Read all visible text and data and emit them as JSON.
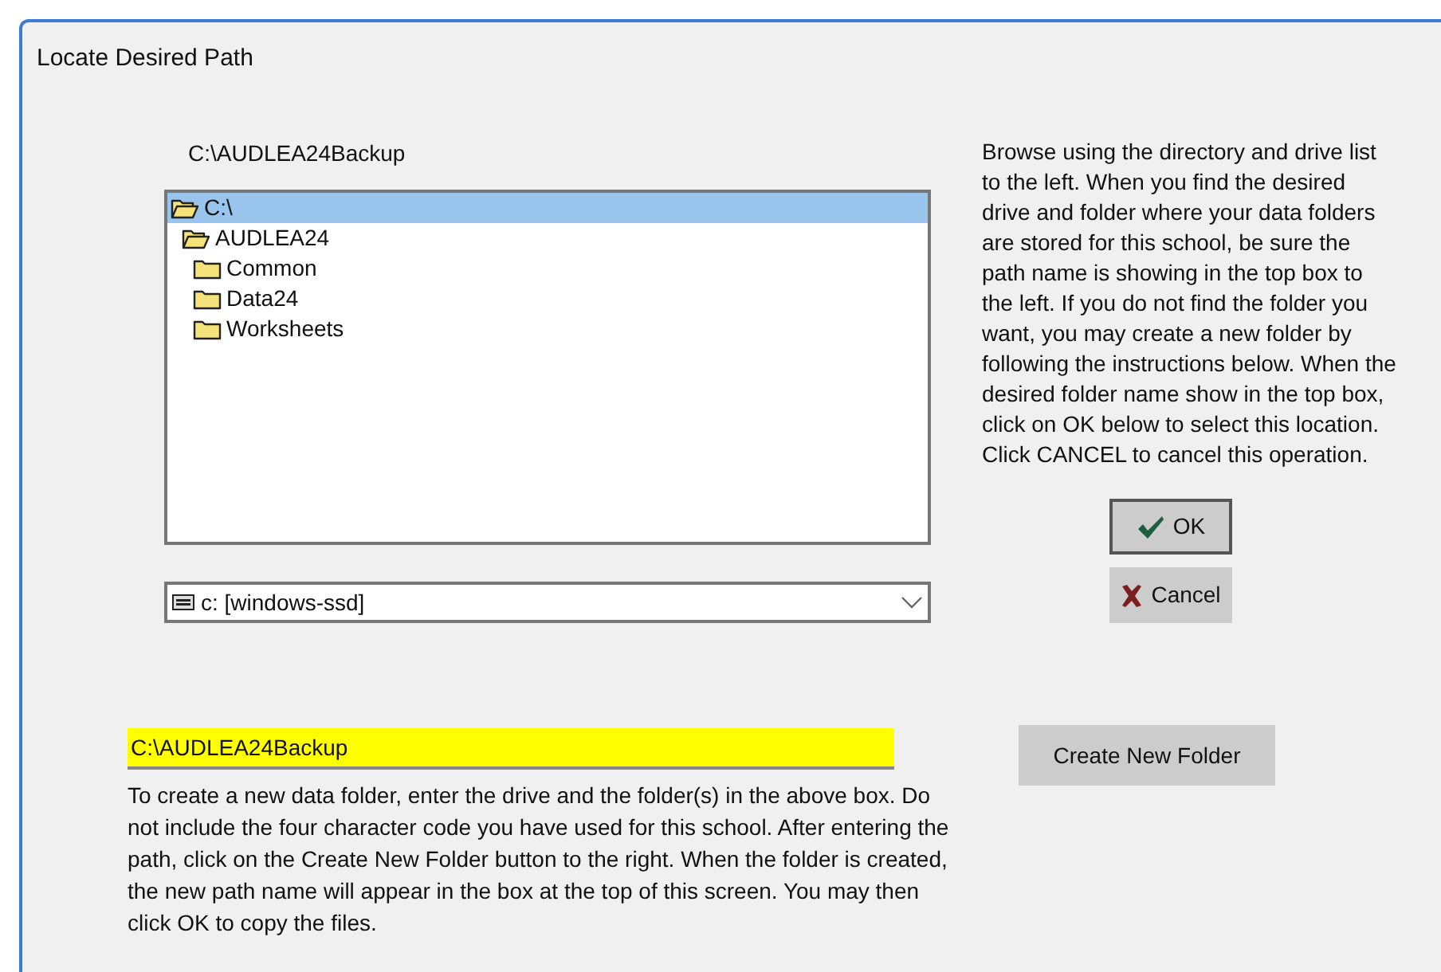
{
  "window": {
    "title": "Locate Desired Path"
  },
  "current_path": "C:\\AUDLEA24Backup",
  "tree": [
    {
      "label": "C:\\",
      "expanded": true,
      "selected": true,
      "children": [
        {
          "label": "AUDLEA24",
          "expanded": true,
          "selected": false,
          "children": [
            {
              "label": "Common",
              "expanded": false,
              "selected": false
            },
            {
              "label": "Data24",
              "expanded": false,
              "selected": false
            },
            {
              "label": "Worksheets",
              "expanded": false,
              "selected": false
            }
          ]
        }
      ]
    }
  ],
  "drive": {
    "value": "c: [windows-ssd]"
  },
  "help_text": "Browse using the directory and drive list to the left.  When you find the desired drive and folder where your data folders are stored for this school, be sure the path name is showing in the top box to the left.  If you do not find the folder you want, you may create a new folder by following the instructions below.  When the desired folder name show in the top box, click on OK below to select this location.  Click CANCEL to cancel this operation.",
  "buttons": [
    {
      "kind": "ok",
      "label": "OK"
    },
    {
      "kind": "cancel",
      "label": "Cancel"
    }
  ],
  "new_folder_field": {
    "value": "C:\\AUDLEA24Backup"
  },
  "new_folder_help": "To create a new data folder, enter the drive and the folder(s) in the above box.  Do not include the four character code you have used for this school.  After entering the path, click on the Create New Folder button to the right.  When the folder is created, the new path name will appear in the box at the top of this screen.  You may then click OK to copy the files.",
  "create_button": {
    "label": "Create New Folder"
  }
}
